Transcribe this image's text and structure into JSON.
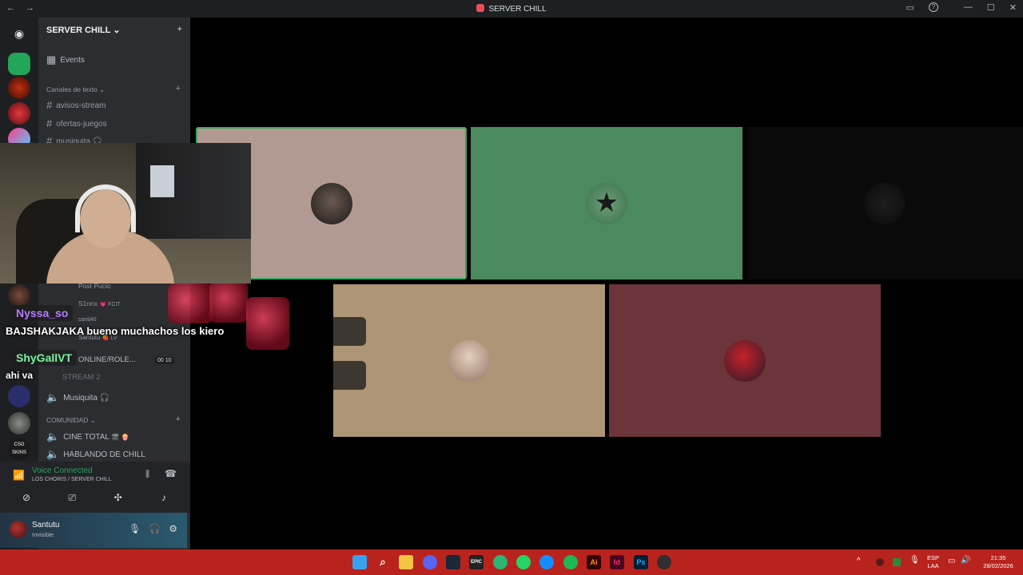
{
  "window": {
    "title": "SERVER CHILL",
    "back": "←",
    "forward": "→",
    "inbox": "▭",
    "help": "?",
    "minimize": "—",
    "maximize": "☐",
    "close": "✕"
  },
  "sidebar": {
    "server_name": "SERVER CHILL",
    "server_chevron": "⌄",
    "invite_icon": "⁺",
    "events_label": "Events",
    "text_category": "Canales de texto",
    "text_channels": [
      "avisos-stream",
      "ofertas-juegos",
      "musiquita 🎧"
    ],
    "voice_members": [
      "Post Pucio",
      "S1nnx",
      "santi40",
      "Santutu"
    ],
    "member_badges": [
      "💗 FCIT",
      "🍓 LV"
    ],
    "online_role_label": "ONLINE/ROLE...",
    "online_counts": [
      "00",
      "10"
    ],
    "stream2_label": "STREAM 2",
    "musiquita_voice": "Musiquita 🎧",
    "community_category": "COMUNIDAD",
    "community_channels": [
      "CINE TOTAL",
      "HABLANDO DE CHILL"
    ],
    "cine_emojis": "🎬 🍿",
    "add_symbol": "+"
  },
  "voice_panel": {
    "status": "Voice Connected",
    "location": "LOS CHORIS / SERVER CHILL"
  },
  "user_panel": {
    "username": "Santutu",
    "status": "Invisible"
  },
  "chat_overlay": [
    {
      "user": "Nyssa_so",
      "color": "#b57bff",
      "message": "BAJSHAKJAKA bueno muchachos los kiero"
    },
    {
      "user": "ShyGallVT",
      "color": "#7cf2a0",
      "message": "ahi va"
    }
  ],
  "taskbar": {
    "apps": [
      "windows",
      "search",
      "files",
      "discord",
      "steam",
      "epic",
      "edge",
      "whatsapp",
      "battlenet",
      "spotify",
      "illustrator",
      "indesign",
      "photoshop",
      "obs"
    ],
    "app_labels": {
      "epic": "EPIC",
      "illustrator": "Ai",
      "indesign": "Id",
      "photoshop": "Ps"
    },
    "language": "ESP",
    "layout": "LAA",
    "time": "21:35",
    "date": "28/02/2026"
  },
  "colors": {
    "tile1": "#b29a92",
    "tile2": "#4a8a5c",
    "tile3": "#0a0a0a",
    "tile4": "#ad9575",
    "tile5": "#6c3539",
    "speaking_border": "#3ba55c",
    "taskbar": "#b9231e"
  }
}
